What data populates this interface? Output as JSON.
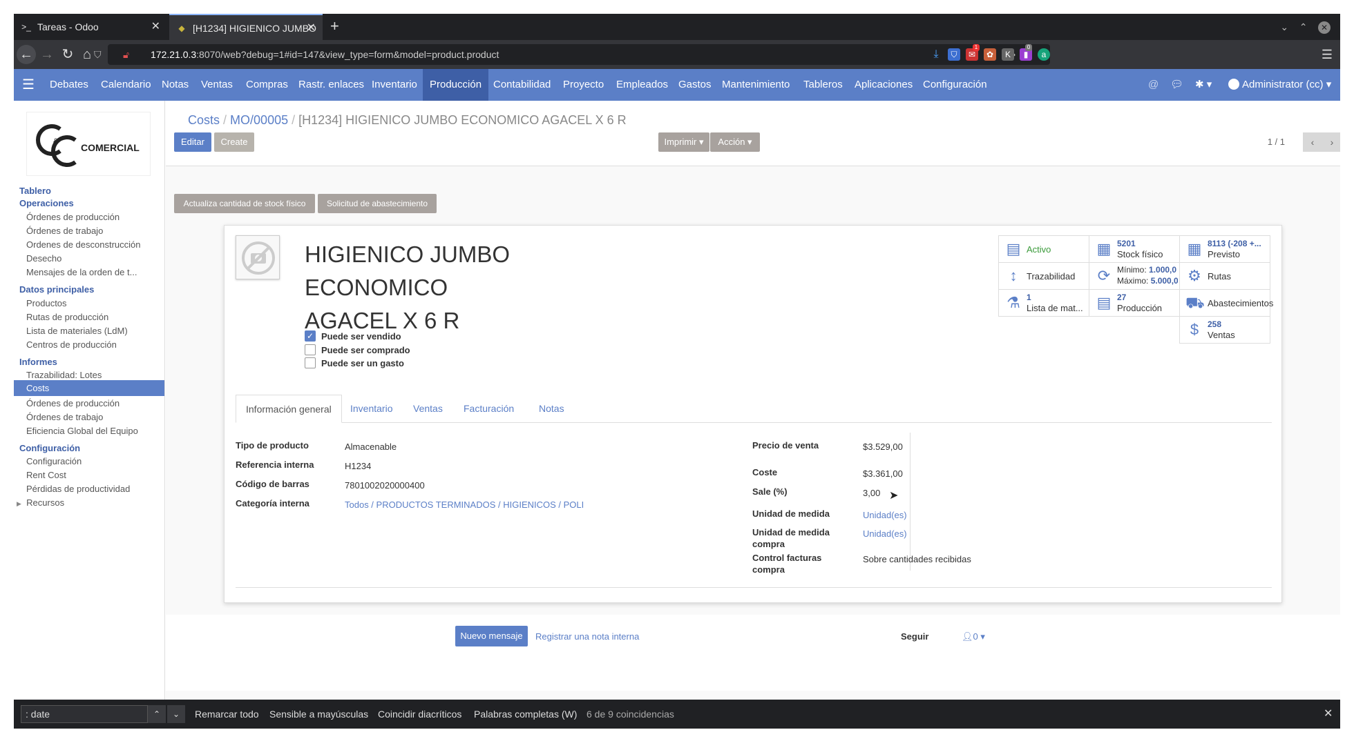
{
  "browser": {
    "tabs": [
      {
        "title": "Tareas - Odoo",
        "active": false
      },
      {
        "title": "[H1234] HIGIENICO JUMBO",
        "active": true
      }
    ],
    "new_tab": "+",
    "url_host": "172.21.0.3",
    "url_rest": ":8070/web?debug=1#id=147&view_type=form&model=product.product",
    "ext_badge_1": "1",
    "ext_badge_2": "0"
  },
  "menu": {
    "items": [
      "Debates",
      "Calendario",
      "Notas",
      "Ventas",
      "Compras",
      "Rastr. enlaces",
      "Inventario",
      "Producción",
      "Contabilidad",
      "Proyecto",
      "Empleados",
      "Gastos",
      "Mantenimiento",
      "Tableros",
      "Aplicaciones",
      "Configuración"
    ],
    "active": "Producción",
    "user": "Administrator (cc)"
  },
  "logo": {
    "text": "COMERCIAL",
    "amp": "&"
  },
  "sidebar": {
    "tablero": "Tablero",
    "operaciones": "Operaciones",
    "op_items": [
      "Órdenes de producción",
      "Órdenes de trabajo",
      "Ordenes de desconstrucción",
      "Desecho",
      "Mensajes de la orden de t..."
    ],
    "datos": "Datos principales",
    "datos_items": [
      "Productos",
      "Rutas de producción",
      "Lista de materiales (LdM)",
      "Centros de producción"
    ],
    "informes": "Informes",
    "inf_items": [
      "Trazabilidad: Lotes",
      "Costs",
      "Órdenes de producción",
      "Órdenes de trabajo",
      "Eficiencia Global del Equipo"
    ],
    "config": "Configuración",
    "config_items": [
      "Configuración",
      "Rent Cost",
      "Pérdidas de productividad"
    ],
    "recursos": "Recursos"
  },
  "breadcrumb": {
    "b1": "Costs",
    "b2": "MO/00005",
    "current": "[H1234] HIGIENICO JUMBO ECONOMICO AGACEL X 6 R"
  },
  "controls": {
    "edit": "Editar",
    "create": "Create",
    "print": "Imprimir",
    "action": "Acción",
    "pager": "1 / 1"
  },
  "header_buttons": {
    "update_stock": "Actualiza cantidad de stock físico",
    "replenish": "Solicitud de abastecimiento"
  },
  "product": {
    "name_l1": "HIGIENICO JUMBO",
    "name_l2": "ECONOMICO",
    "name_l3": "AGACEL X 6 R",
    "sale_ok": "Puede ser vendido",
    "purchase_ok": "Puede ser comprado",
    "expense_ok": "Puede ser un gasto"
  },
  "smart_buttons": {
    "activo": "Activo",
    "stock_val": "5201",
    "stock_lbl": "Stock físico",
    "prev_val": "8113 (-208 +...",
    "prev_lbl": "Previsto",
    "traz": "Trazabilidad",
    "min": "Mínimo:",
    "min_val": "1.000,0",
    "max": "Máximo:",
    "max_val": "5.000,0",
    "rutas": "Rutas",
    "bom_val": "1",
    "bom_lbl": "Lista de mat...",
    "prod_val": "27",
    "prod_lbl": "Producción",
    "abast": "Abastecimientos",
    "sales_val": "258",
    "sales_lbl": "Ventas"
  },
  "form_tabs": [
    "Información general",
    "Inventario",
    "Ventas",
    "Facturación",
    "Notas"
  ],
  "fields": {
    "tipo_lbl": "Tipo de producto",
    "tipo": "Almacenable",
    "ref_lbl": "Referencia interna",
    "ref": "H1234",
    "barcode_lbl": "Código de barras",
    "barcode": "7801002020000400",
    "categ_lbl": "Categoría interna",
    "categ": "Todos / PRODUCTOS TERMINADOS / HIGIENICOS / POLI",
    "precio_lbl": "Precio de venta",
    "precio": "$3.529,00",
    "coste_lbl": "Coste",
    "coste": "$3.361,00",
    "sale_lbl": "Sale (%)",
    "sale": "3,00",
    "uom_lbl": "Unidad de medida",
    "uom": "Unidad(es)",
    "uom_po_lbl1": "Unidad de medida",
    "uom_po_lbl2": "compra",
    "uom_po": "Unidad(es)",
    "ctrl_lbl1": "Control facturas",
    "ctrl_lbl2": "compra",
    "ctrl": "Sobre cantidades recibidas"
  },
  "chatter": {
    "new_msg": "Nuevo mensaje",
    "note": "Registrar una nota interna",
    "follow": "Seguir",
    "followers": "0"
  },
  "findbar": {
    "query": ": date",
    "highlight_all": "Remarcar todo",
    "match_case": "Sensible a mayúsculas",
    "diacritics": "Coincidir diacríticos",
    "whole_words": "Palabras completas (W)",
    "result": "6 de 9 coincidencias"
  }
}
